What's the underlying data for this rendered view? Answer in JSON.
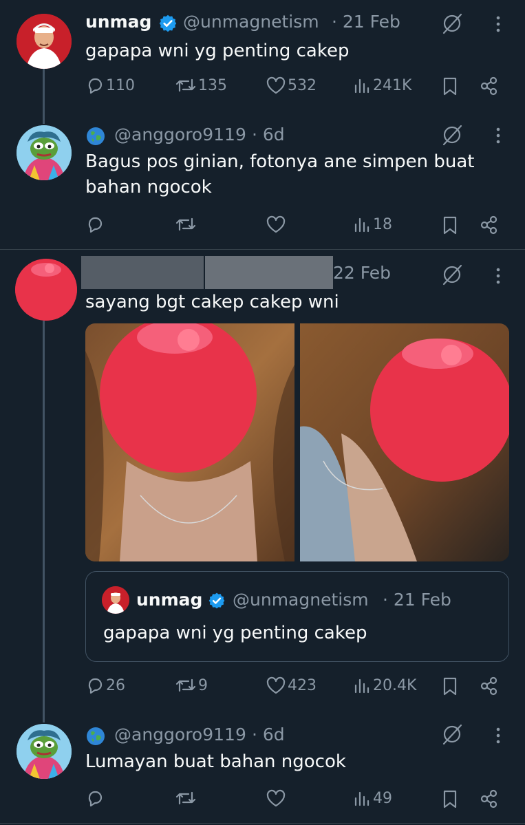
{
  "tweets": [
    {
      "name": "unmag",
      "handle": "@unmagnetism",
      "time": "· 21 Feb",
      "text": "gapapa wni yg penting cakep",
      "replies": "110",
      "retweets": "135",
      "likes": "532",
      "views": "241K"
    },
    {
      "handle": "@anggoro9119",
      "time": "· 6d",
      "text": "Bagus pos ginian, fotonya ane simpen buat bahan ngocok",
      "replies": "",
      "retweets": "",
      "likes": "",
      "views": "18"
    },
    {
      "time": "22 Feb",
      "text": "sayang bgt cakep cakep wni",
      "quote": {
        "name": "unmag",
        "handle": "@unmagnetism",
        "time": "· 21 Feb",
        "text": "gapapa wni yg penting cakep"
      },
      "replies": "26",
      "retweets": "9",
      "likes": "423",
      "views": "20.4K"
    },
    {
      "handle": "@anggoro9119",
      "time": "· 6d",
      "text": "Lumayan buat bahan ngocok",
      "replies": "",
      "retweets": "",
      "likes": "",
      "views": "49"
    }
  ],
  "colors": {
    "background": "#15202b",
    "text": "#f7f9f9",
    "muted": "#8b98a5",
    "verified": "#1d9bf0",
    "redaction": "#e8334a"
  },
  "icons": [
    "reply-icon",
    "retweet-icon",
    "like-icon",
    "views-icon",
    "bookmark-icon",
    "share-icon",
    "grok-icon",
    "more-icon",
    "verified-badge-icon",
    "globe-icon"
  ]
}
